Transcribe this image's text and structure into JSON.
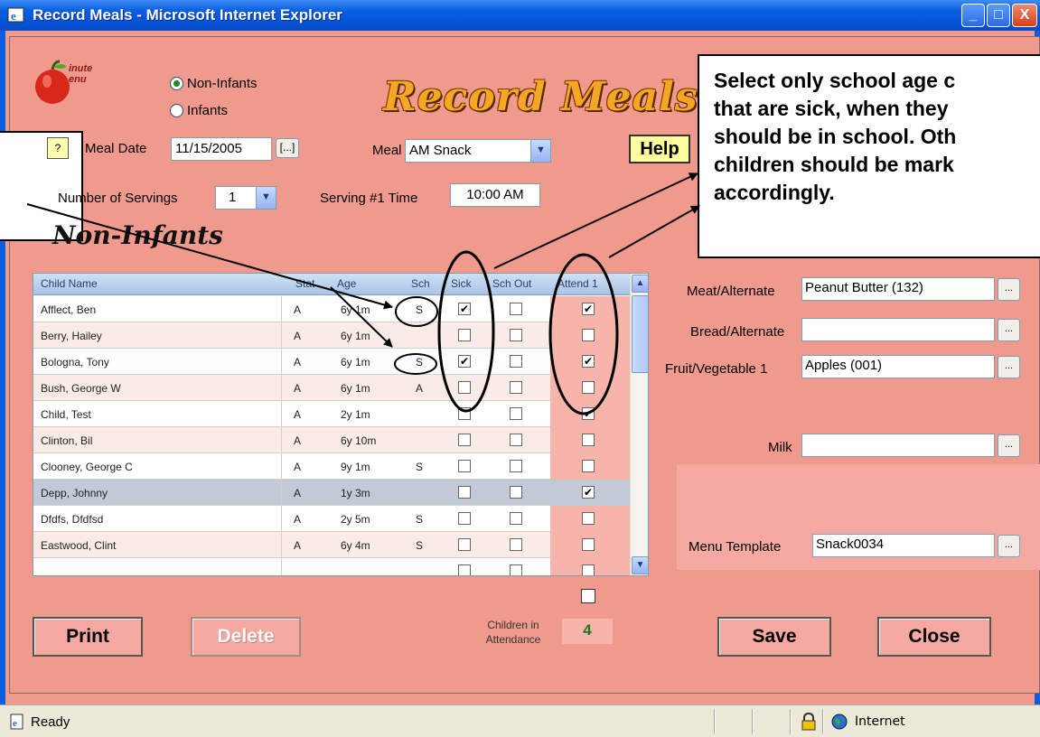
{
  "window": {
    "title": "Record Meals - Microsoft Internet Explorer",
    "min_glyph": "_",
    "max_glyph": "□",
    "close_glyph": "X"
  },
  "logo": {
    "word1": "inute",
    "word2": "enu"
  },
  "mode": {
    "options": [
      "Non-Infants",
      "Infants"
    ],
    "selected": "Non-Infants"
  },
  "heading": "Record Meals",
  "callout_text": "Select only school age c\nthat are sick, when they\nshould be in school. Oth\nchildren should be mark\naccordingly.",
  "form": {
    "help_icon_label": "?",
    "meal_date_label": "Meal Date",
    "meal_date_value": "11/15/2005",
    "date_picker_label": "[...]",
    "meal_label": "Meal",
    "meal_value": "AM Snack",
    "help_label": "Help",
    "servings_label": "Number of Servings",
    "servings_value": "1",
    "serving_time_label": "Serving #1 Time",
    "serving_time_value": "10:00 AM",
    "section_label": "Non-Infants"
  },
  "table": {
    "columns": [
      "Child Name",
      "Stat",
      "Age",
      "Sch",
      "Sick",
      "Sch Out",
      "Attend 1"
    ],
    "rows": [
      {
        "name": "Afflect, Ben",
        "stat": "A",
        "age": "6y 1m",
        "sch": "S",
        "sick": true,
        "sch_out": false,
        "attend": true
      },
      {
        "name": "Berry, Hailey",
        "stat": "A",
        "age": "6y 1m",
        "sch": "",
        "sick": false,
        "sch_out": false,
        "attend": false
      },
      {
        "name": "Bologna, Tony",
        "stat": "A",
        "age": "6y 1m",
        "sch": "S",
        "sick": true,
        "sch_out": false,
        "attend": true
      },
      {
        "name": "Bush, George W",
        "stat": "A",
        "age": "6y 1m",
        "sch": "A",
        "sick": false,
        "sch_out": false,
        "attend": false
      },
      {
        "name": "Child, Test",
        "stat": "A",
        "age": "2y 1m",
        "sch": "",
        "sick": false,
        "sch_out": false,
        "attend": true
      },
      {
        "name": "Clinton, Bil",
        "stat": "A",
        "age": "6y 10m",
        "sch": "",
        "sick": false,
        "sch_out": false,
        "attend": false
      },
      {
        "name": "Clooney, George C",
        "stat": "A",
        "age": "9y 1m",
        "sch": "S",
        "sick": false,
        "sch_out": false,
        "attend": false
      },
      {
        "name": "Depp, Johnny",
        "stat": "A",
        "age": "1y 3m",
        "sch": "",
        "sick": false,
        "sch_out": false,
        "attend": true,
        "selected": true
      },
      {
        "name": "Dfdfs, Dfdfsd",
        "stat": "A",
        "age": "2y 5m",
        "sch": "S",
        "sick": false,
        "sch_out": false,
        "attend": false
      },
      {
        "name": "Eastwood, Clint",
        "stat": "A",
        "age": "6y 4m",
        "sch": "S",
        "sick": false,
        "sch_out": false,
        "attend": false
      },
      {
        "name": "",
        "stat": "",
        "age": "",
        "sch": "",
        "sick": false,
        "sch_out": false,
        "attend": false
      }
    ]
  },
  "components": {
    "meat_label": "Meat/Alternate",
    "meat_value": "Peanut Butter (132)",
    "bread_label": "Bread/Alternate",
    "bread_value": "",
    "fruit_label": "Fruit/Vegetable 1",
    "fruit_value": "Apples (001)",
    "milk_label": "Milk",
    "milk_value": "",
    "menu_template_label": "Menu Template",
    "menu_template_value": "Snack0034",
    "browse_label": "..."
  },
  "footer": {
    "print_label": "Print",
    "delete_label": "Delete",
    "children_label": "Children in\nAttendance",
    "children_count": "4",
    "save_label": "Save",
    "close_label": "Close"
  },
  "status": {
    "text": "Ready",
    "zone": "Internet"
  },
  "colors": {
    "background": "#f09a8e",
    "titlebar": "#0a5ee0",
    "heading": "#f5a623"
  }
}
